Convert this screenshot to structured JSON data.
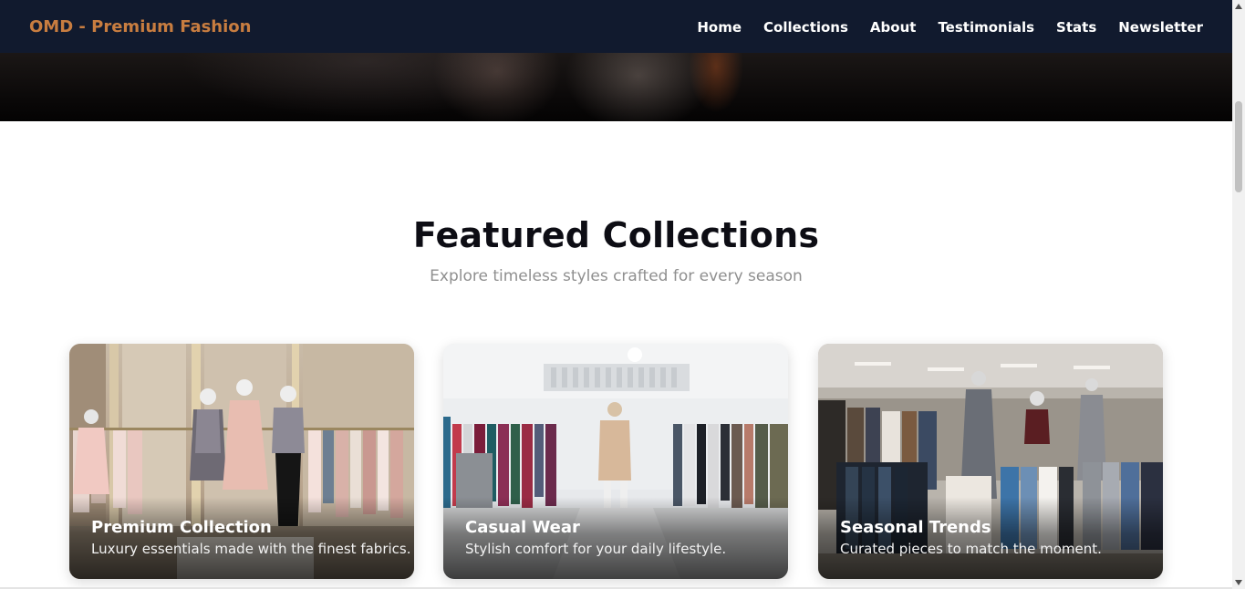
{
  "brand": {
    "name": "OMD - Premium Fashion",
    "color": "#c87d40"
  },
  "nav": {
    "items": [
      {
        "label": "Home"
      },
      {
        "label": "Collections"
      },
      {
        "label": "About"
      },
      {
        "label": "Testimonials"
      },
      {
        "label": "Stats"
      },
      {
        "label": "Newsletter"
      }
    ],
    "background": "#111a2e"
  },
  "featured": {
    "title": "Featured Collections",
    "subtitle": "Explore timeless styles crafted for every season",
    "cards": [
      {
        "title": "Premium Collection",
        "description": "Luxury essentials made with the finest fabrics.",
        "image_icon": "boutique-mannequins-image"
      },
      {
        "title": "Casual Wear",
        "description": "Stylish comfort for your daily lifestyle.",
        "image_icon": "store-aisle-image"
      },
      {
        "title": "Seasonal Trends",
        "description": "Curated pieces to match the moment.",
        "image_icon": "clothing-racks-image"
      }
    ]
  },
  "scrollbar": {
    "up_icon": "scroll-up-arrow-icon",
    "down_icon": "scroll-down-arrow-icon"
  }
}
